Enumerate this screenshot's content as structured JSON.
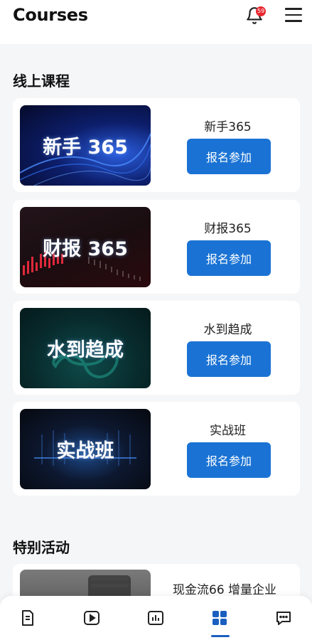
{
  "header": {
    "title": "Courses",
    "notification_count": "59"
  },
  "sections": {
    "online_courses": "线上课程",
    "special_events": "特别活动"
  },
  "courses": [
    {
      "thumb_text": "新手 365",
      "name": "新手365",
      "button": "报名参加"
    },
    {
      "thumb_text": "财报 365",
      "name": "财报365",
      "button": "报名参加"
    },
    {
      "thumb_text": "水到趋成",
      "name": "水到趋成",
      "button": "报名参加"
    },
    {
      "thumb_text": "实战班",
      "name": "实战班",
      "button": "报名参加"
    }
  ],
  "event": {
    "name": "现金流66 增量企业"
  },
  "tabbar": {
    "active_tab": "grid",
    "tabs": [
      "document-icon",
      "play-icon",
      "chart-icon",
      "grid-icon",
      "chat-icon"
    ]
  },
  "colors": {
    "primary": "#1a73d4",
    "badge": "#e8262e",
    "active_tab": "#1a5fc0"
  }
}
